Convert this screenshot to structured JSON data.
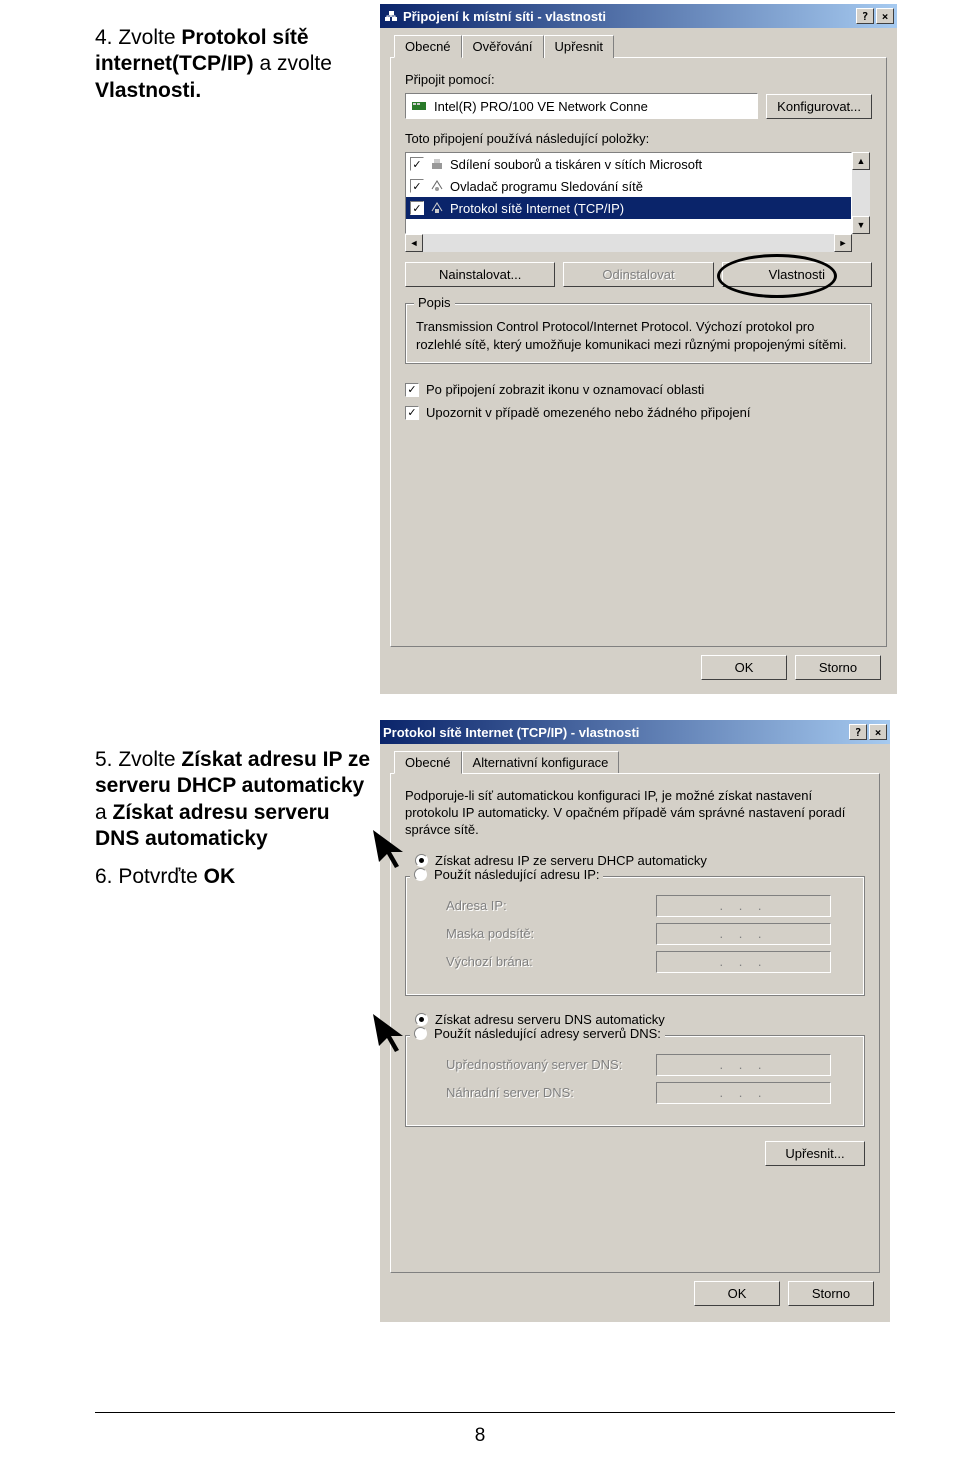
{
  "page_number": "8",
  "step4": {
    "num": "4.",
    "line1_a": "Zvolte ",
    "line1_b": "Protokol sítě internet(TCP/IP)",
    "line1_c": " a zvolte ",
    "line1_d": "Vlastnosti."
  },
  "step5": {
    "num": "5.",
    "a": "Zvolte ",
    "b": "Získat adresu IP ze serveru DHCP automaticky",
    "c": "  a ",
    "d": "Získat adresu serveru DNS automaticky"
  },
  "step6": {
    "num": "6.",
    "a": "Potvrďte ",
    "b": "OK"
  },
  "dialog1": {
    "title": "Připojení k místní síti - vlastnosti",
    "help": "?",
    "close": "×",
    "tabs": [
      "Obecné",
      "Ověřování",
      "Upřesnit"
    ],
    "connect_label": "Připojit pomocí:",
    "adapter": "Intel(R) PRO/100 VE Network Conne",
    "configure_btn": "Konfigurovat...",
    "items_label": "Toto připojení používá následující položky:",
    "items": [
      "Sdílení souborů a tiskáren v sítích Microsoft",
      "Ovladač programu Sledování sítě",
      "Protokol sítě Internet (TCP/IP)"
    ],
    "install_btn": "Nainstalovat...",
    "uninstall_btn": "Odinstalovat",
    "props_btn": "Vlastnosti",
    "desc_legend": "Popis",
    "desc_text": "Transmission Control Protocol/Internet Protocol. Výchozí protokol pro rozlehlé sítě, který umožňuje komunikaci mezi různými propojenými sítěmi.",
    "chk1": "Po připojení zobrazit ikonu v oznamovací oblasti",
    "chk2": "Upozornit v případě omezeného nebo žádného připojení",
    "ok": "OK",
    "cancel": "Storno"
  },
  "dialog2": {
    "title": "Protokol sítě Internet (TCP/IP) - vlastnosti",
    "help": "?",
    "close": "×",
    "tabs": [
      "Obecné",
      "Alternativní konfigurace"
    ],
    "intro": "Podporuje-li síť automatickou konfiguraci IP, je možné získat nastavení protokolu IP automaticky. V opačném případě vám správné nastavení poradí správce sítě.",
    "radio_ip_auto": "Získat adresu IP ze serveru DHCP automaticky",
    "radio_ip_manual": "Použít následující adresu IP:",
    "ip_label": "Adresa IP:",
    "mask_label": "Maska podsítě:",
    "gateway_label": "Výchozí brána:",
    "radio_dns_auto": "Získat adresu serveru DNS automaticky",
    "radio_dns_manual": "Použít následující adresy serverů DNS:",
    "dns1_label": "Upřednostňovaný server DNS:",
    "dns2_label": "Náhradní server DNS:",
    "advanced_btn": "Upřesnit...",
    "ok": "OK",
    "cancel": "Storno"
  }
}
